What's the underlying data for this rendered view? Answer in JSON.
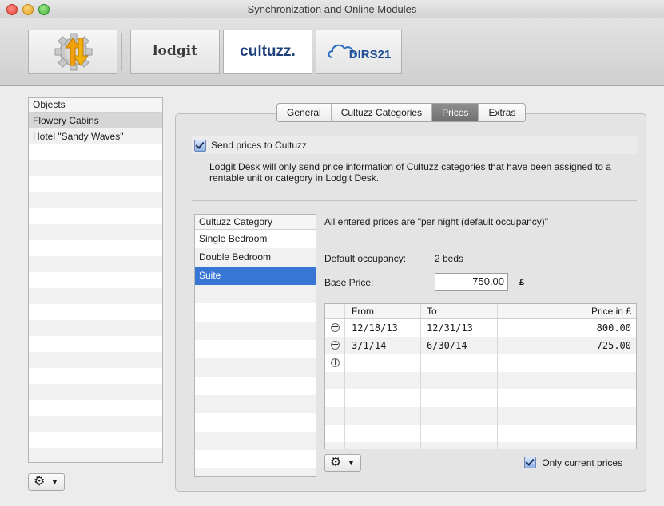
{
  "window": {
    "title": "Synchronization and Online Modules"
  },
  "toolbar": {
    "sync_icon": "sync-arrows-gear-icon",
    "lodgit_label": "lodgit",
    "cultuzz_label": "cultuzz.",
    "dirs21_label": "DIRS21"
  },
  "objects": {
    "header": "Objects",
    "items": [
      "Flowery Cabins",
      "Hotel \"Sandy Waves\""
    ],
    "selected_index": 0
  },
  "tabs": [
    "General",
    "Cultuzz Categories",
    "Prices",
    "Extras"
  ],
  "selected_tab": 2,
  "send_prices": {
    "label": "Send prices to Cultuzz",
    "checked": true,
    "description": "Lodgit Desk will only send price information of Cultuzz categories that have been assigned to a rentable unit or category in Lodgit Desk."
  },
  "categories": {
    "header": "Cultuzz Category",
    "items": [
      "Single Bedroom",
      "Double Bedroom",
      "Suite"
    ],
    "selected_index": 2
  },
  "prices": {
    "note": "All entered prices are \"per night (default occupancy)\"",
    "occupancy_label": "Default occupancy:",
    "occupancy_value": "2 beds",
    "base_label": "Base Price:",
    "base_value": "750.00",
    "currency": "£",
    "columns": [
      "From",
      "To",
      "Price in £"
    ],
    "rows": [
      {
        "from": "12/18/13",
        "to": "12/31/13",
        "price": "800.00"
      },
      {
        "from": "3/1/14",
        "to": "6/30/14",
        "price": "725.00"
      }
    ],
    "only_current_label": "Only current prices",
    "only_current_checked": true
  },
  "colors": {
    "selection": "#3876d6",
    "checkbox": "#8fb2e6"
  }
}
